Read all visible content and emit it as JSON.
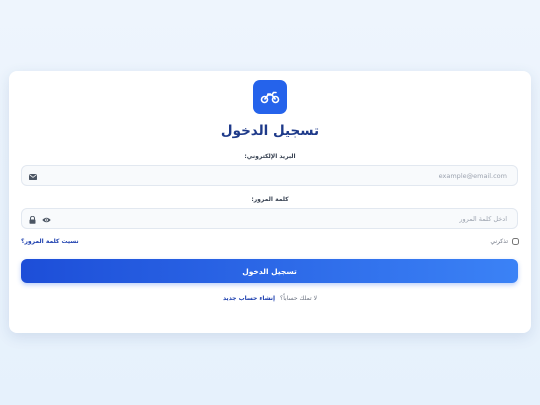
{
  "login": {
    "title": "تسجيل الدخول",
    "logo_icon": "motorcycle-icon",
    "email": {
      "label": "البريد الإلكتروني:",
      "placeholder": "example@email.com",
      "value": "",
      "icon": "envelope-icon"
    },
    "password": {
      "label": "كلمة المرور:",
      "placeholder": "ادخل كلمة المرور",
      "value": "",
      "icon": "lock-icon",
      "toggle_icon": "eye-icon"
    },
    "remember_label": "تذكرني",
    "remember_checked": false,
    "forgot_label": "نسيت كلمة المرور؟",
    "submit_label": "تسجيل الدخول",
    "no_account_text": "لا تملك حساباً؟",
    "signup_label": "إنشاء حساب جديد"
  },
  "colors": {
    "primary": "#2563eb",
    "title": "#1e3a8a",
    "link": "#1e40af",
    "background": "#eef5fd"
  }
}
